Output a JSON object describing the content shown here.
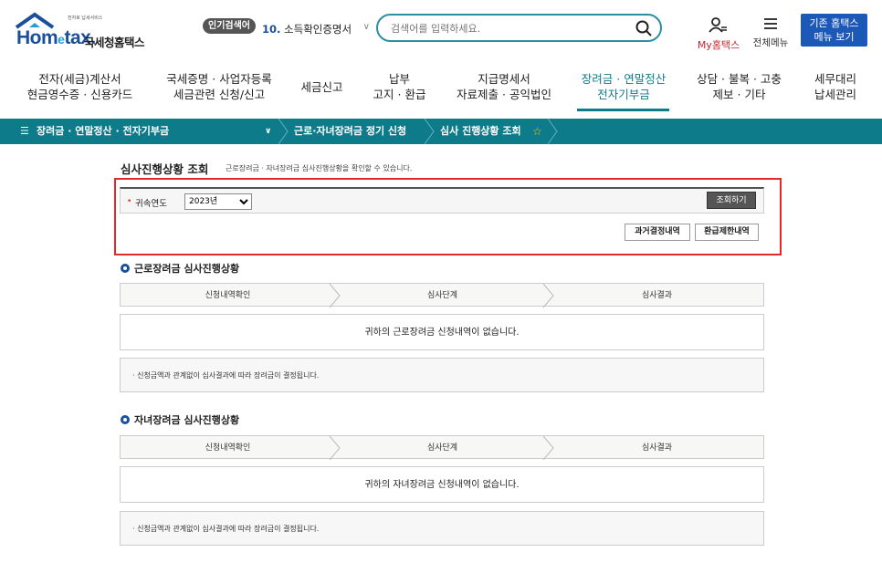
{
  "header": {
    "logo_small_text": "전자로 납세서비스",
    "logo_brand_main": "Hom",
    "logo_brand_e": "e",
    "logo_brand_tail": "tax.",
    "logo_org": "국세청홈택스",
    "popular_badge": "인기검색어",
    "popular_rank": "10.",
    "popular_term": "소득확인증명서",
    "search_placeholder": "검색어를 입력하세요.",
    "myhome_label": "My홈택스",
    "allmenu_label": "전체메뉴",
    "oldmenu_line1": "기존 홈택스",
    "oldmenu_line2": "메뉴 보기"
  },
  "nav": [
    {
      "line1": "전자(세금)계산서",
      "line2": "현금영수증 · 신용카드"
    },
    {
      "line1": "국세증명 · 사업자등록",
      "line2": "세금관련 신청/신고"
    },
    {
      "line1": "세금신고",
      "line2": ""
    },
    {
      "line1": "납부",
      "line2": "고지 · 환급"
    },
    {
      "line1": "지급명세서",
      "line2": "자료제출 · 공익법인"
    },
    {
      "line1": "장려금 · 연말정산",
      "line2": "전자기부금"
    },
    {
      "line1": "상담 · 불복 · 고충",
      "line2": "제보 · 기타"
    },
    {
      "line1": "세무대리",
      "line2": "납세관리"
    }
  ],
  "breadcrumb": {
    "menu": "장려금 · 연말정산 · 전자기부금",
    "item2": "근로·자녀장려금 정기 신청",
    "item3": "심사 진행상황 조회"
  },
  "page": {
    "title": "심사진행상황 조회",
    "description": "근로장려금 · 자녀장려금 심사진행상황을 확인할 수 있습니다."
  },
  "filter": {
    "label": "귀속연도",
    "year_selected": "2023년",
    "search_button": "조회하기",
    "past_button": "과거결정내역",
    "refund_button": "환급제한내역"
  },
  "sections": [
    {
      "title": "근로장려금 심사진행상황",
      "steps": [
        "신청내역확인",
        "심사단계",
        "심사결과"
      ],
      "empty_message": "귀하의 근로장려금 신청내역이 없습니다.",
      "note": "· 신청금액과 관계없이 심사결과에 따라 장려금이 결정됩니다."
    },
    {
      "title": "자녀장려금 심사진행상황",
      "steps": [
        "신청내역확인",
        "심사단계",
        "심사결과"
      ],
      "empty_message": "귀하의 자녀장려금 신청내역이 없습니다.",
      "note": "· 신청금액과 관계없이 심사결과에 따라 장려금이 결정됩니다."
    }
  ],
  "colors": {
    "teal": "#0e7b8a",
    "brand_blue": "#1a4f9c",
    "highlight_red": "#e32a2a",
    "old_menu_bg": "#1c58b7"
  },
  "icons": {
    "search": "search-icon",
    "user": "user-icon",
    "menu": "hamburger-icon",
    "star": "star-icon"
  }
}
